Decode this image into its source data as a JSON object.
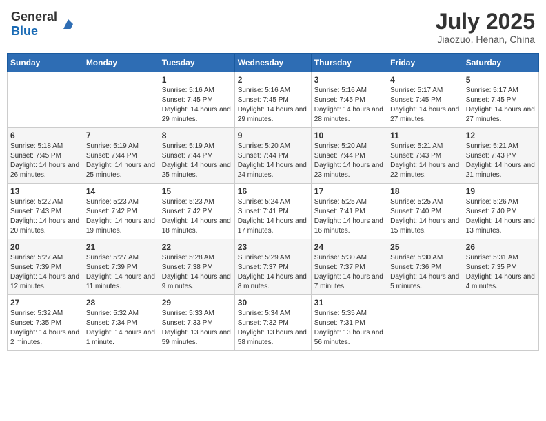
{
  "header": {
    "logo_general": "General",
    "logo_blue": "Blue",
    "month_title": "July 2025",
    "subtitle": "Jiaozuo, Henan, China"
  },
  "weekdays": [
    "Sunday",
    "Monday",
    "Tuesday",
    "Wednesday",
    "Thursday",
    "Friday",
    "Saturday"
  ],
  "weeks": [
    [
      {
        "day": "",
        "info": ""
      },
      {
        "day": "",
        "info": ""
      },
      {
        "day": "1",
        "info": "Sunrise: 5:16 AM\nSunset: 7:45 PM\nDaylight: 14 hours and 29 minutes."
      },
      {
        "day": "2",
        "info": "Sunrise: 5:16 AM\nSunset: 7:45 PM\nDaylight: 14 hours and 29 minutes."
      },
      {
        "day": "3",
        "info": "Sunrise: 5:16 AM\nSunset: 7:45 PM\nDaylight: 14 hours and 28 minutes."
      },
      {
        "day": "4",
        "info": "Sunrise: 5:17 AM\nSunset: 7:45 PM\nDaylight: 14 hours and 27 minutes."
      },
      {
        "day": "5",
        "info": "Sunrise: 5:17 AM\nSunset: 7:45 PM\nDaylight: 14 hours and 27 minutes."
      }
    ],
    [
      {
        "day": "6",
        "info": "Sunrise: 5:18 AM\nSunset: 7:45 PM\nDaylight: 14 hours and 26 minutes."
      },
      {
        "day": "7",
        "info": "Sunrise: 5:19 AM\nSunset: 7:44 PM\nDaylight: 14 hours and 25 minutes."
      },
      {
        "day": "8",
        "info": "Sunrise: 5:19 AM\nSunset: 7:44 PM\nDaylight: 14 hours and 25 minutes."
      },
      {
        "day": "9",
        "info": "Sunrise: 5:20 AM\nSunset: 7:44 PM\nDaylight: 14 hours and 24 minutes."
      },
      {
        "day": "10",
        "info": "Sunrise: 5:20 AM\nSunset: 7:44 PM\nDaylight: 14 hours and 23 minutes."
      },
      {
        "day": "11",
        "info": "Sunrise: 5:21 AM\nSunset: 7:43 PM\nDaylight: 14 hours and 22 minutes."
      },
      {
        "day": "12",
        "info": "Sunrise: 5:21 AM\nSunset: 7:43 PM\nDaylight: 14 hours and 21 minutes."
      }
    ],
    [
      {
        "day": "13",
        "info": "Sunrise: 5:22 AM\nSunset: 7:43 PM\nDaylight: 14 hours and 20 minutes."
      },
      {
        "day": "14",
        "info": "Sunrise: 5:23 AM\nSunset: 7:42 PM\nDaylight: 14 hours and 19 minutes."
      },
      {
        "day": "15",
        "info": "Sunrise: 5:23 AM\nSunset: 7:42 PM\nDaylight: 14 hours and 18 minutes."
      },
      {
        "day": "16",
        "info": "Sunrise: 5:24 AM\nSunset: 7:41 PM\nDaylight: 14 hours and 17 minutes."
      },
      {
        "day": "17",
        "info": "Sunrise: 5:25 AM\nSunset: 7:41 PM\nDaylight: 14 hours and 16 minutes."
      },
      {
        "day": "18",
        "info": "Sunrise: 5:25 AM\nSunset: 7:40 PM\nDaylight: 14 hours and 15 minutes."
      },
      {
        "day": "19",
        "info": "Sunrise: 5:26 AM\nSunset: 7:40 PM\nDaylight: 14 hours and 13 minutes."
      }
    ],
    [
      {
        "day": "20",
        "info": "Sunrise: 5:27 AM\nSunset: 7:39 PM\nDaylight: 14 hours and 12 minutes."
      },
      {
        "day": "21",
        "info": "Sunrise: 5:27 AM\nSunset: 7:39 PM\nDaylight: 14 hours and 11 minutes."
      },
      {
        "day": "22",
        "info": "Sunrise: 5:28 AM\nSunset: 7:38 PM\nDaylight: 14 hours and 9 minutes."
      },
      {
        "day": "23",
        "info": "Sunrise: 5:29 AM\nSunset: 7:37 PM\nDaylight: 14 hours and 8 minutes."
      },
      {
        "day": "24",
        "info": "Sunrise: 5:30 AM\nSunset: 7:37 PM\nDaylight: 14 hours and 7 minutes."
      },
      {
        "day": "25",
        "info": "Sunrise: 5:30 AM\nSunset: 7:36 PM\nDaylight: 14 hours and 5 minutes."
      },
      {
        "day": "26",
        "info": "Sunrise: 5:31 AM\nSunset: 7:35 PM\nDaylight: 14 hours and 4 minutes."
      }
    ],
    [
      {
        "day": "27",
        "info": "Sunrise: 5:32 AM\nSunset: 7:35 PM\nDaylight: 14 hours and 2 minutes."
      },
      {
        "day": "28",
        "info": "Sunrise: 5:32 AM\nSunset: 7:34 PM\nDaylight: 14 hours and 1 minute."
      },
      {
        "day": "29",
        "info": "Sunrise: 5:33 AM\nSunset: 7:33 PM\nDaylight: 13 hours and 59 minutes."
      },
      {
        "day": "30",
        "info": "Sunrise: 5:34 AM\nSunset: 7:32 PM\nDaylight: 13 hours and 58 minutes."
      },
      {
        "day": "31",
        "info": "Sunrise: 5:35 AM\nSunset: 7:31 PM\nDaylight: 13 hours and 56 minutes."
      },
      {
        "day": "",
        "info": ""
      },
      {
        "day": "",
        "info": ""
      }
    ]
  ]
}
